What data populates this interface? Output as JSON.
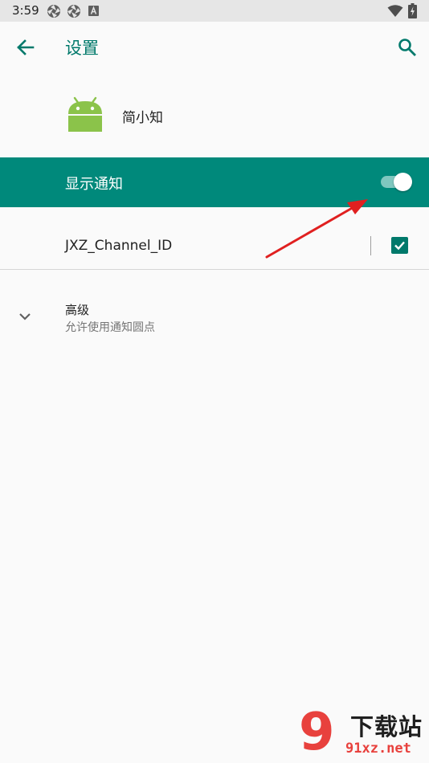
{
  "status_bar": {
    "time": "3:59",
    "icons": [
      "aperture-icon",
      "aperture-icon",
      "a-box-icon",
      "wifi-icon",
      "battery-charging-icon"
    ]
  },
  "app_bar": {
    "title": "设置",
    "back_icon": "arrow-back-icon",
    "search_icon": "search-icon"
  },
  "app": {
    "name": "简小知",
    "icon": "android-robot-icon"
  },
  "master_toggle": {
    "label": "显示通知",
    "on": true
  },
  "channel": {
    "label": "JXZ_Channel_ID",
    "checked": true
  },
  "advanced": {
    "title": "高级",
    "summary": "允许使用通知圆点",
    "icon": "chevron-down-icon"
  },
  "watermark": {
    "logo": "9",
    "brand": "下载站",
    "domain": "91xz.net"
  },
  "colors": {
    "accent": "#00796b",
    "master_bg": "#00897b",
    "switch_track": "#7fc7bf",
    "android_green": "#8bc34a",
    "annotation_red": "#e02020"
  }
}
